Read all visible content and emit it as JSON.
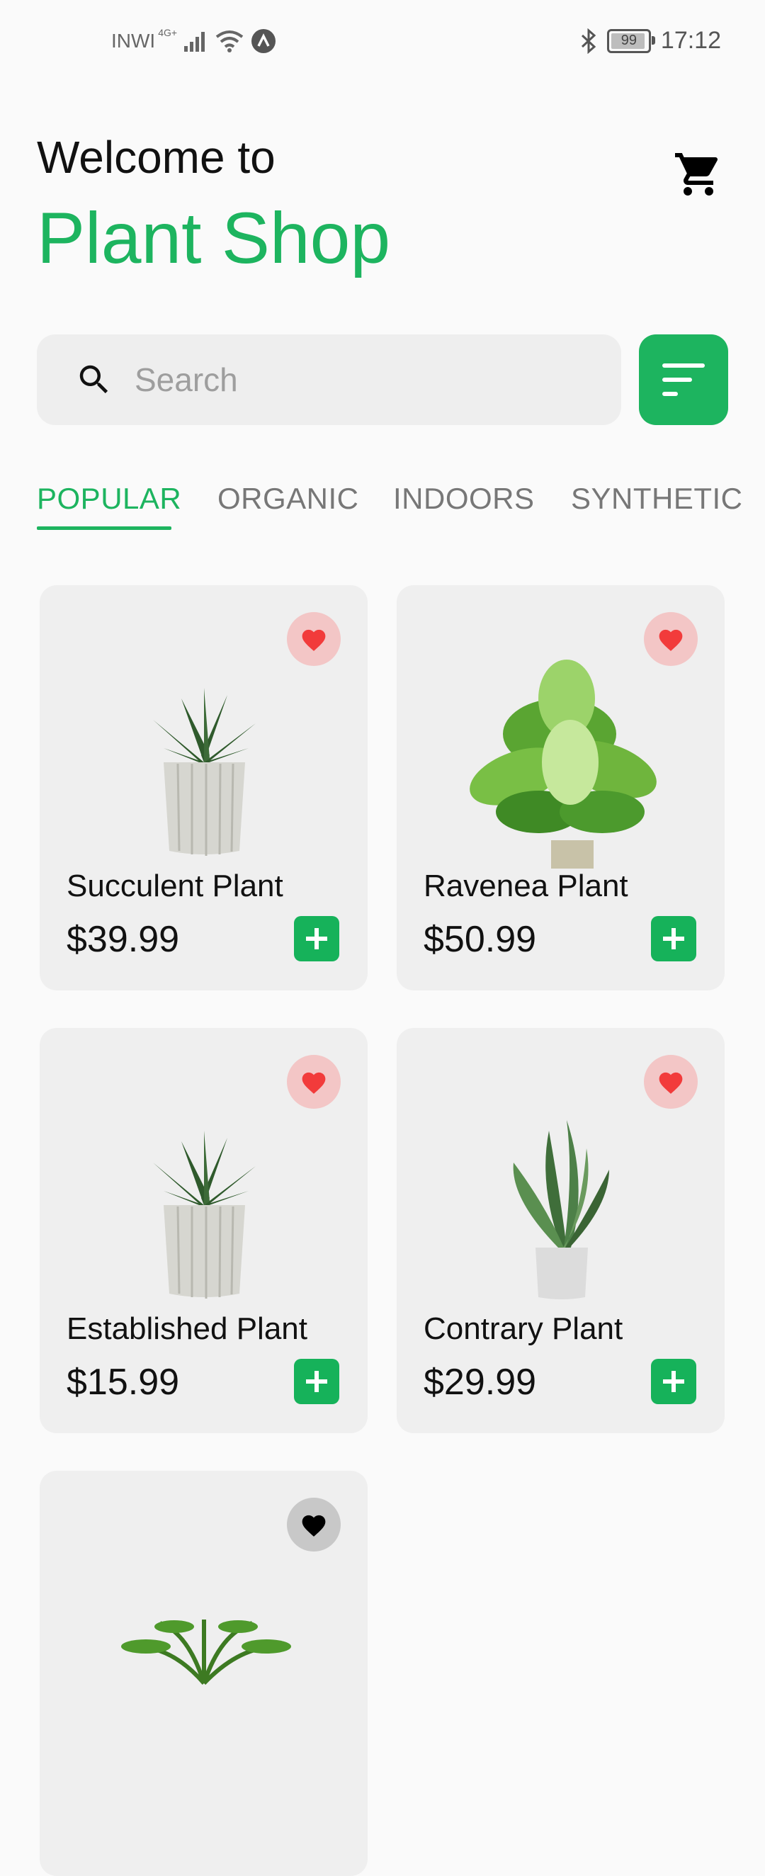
{
  "status_bar": {
    "carrier": "INWI",
    "network": "4G+",
    "battery": "99",
    "time": "17:12"
  },
  "header": {
    "welcome": "Welcome to",
    "title": "Plant Shop",
    "cart_icon": "cart-icon"
  },
  "search": {
    "placeholder": "Search",
    "filter_icon": "filter-icon"
  },
  "tabs": [
    {
      "label": "POPULAR",
      "active": true
    },
    {
      "label": "ORGANIC",
      "active": false
    },
    {
      "label": "INDOORS",
      "active": false
    },
    {
      "label": "SYNTHETIC",
      "active": false
    }
  ],
  "products": [
    {
      "name": "Succulent Plant",
      "price": "$39.99",
      "favorite": true
    },
    {
      "name": "Ravenea Plant",
      "price": "$50.99",
      "favorite": true
    },
    {
      "name": "Established Plant",
      "price": "$15.99",
      "favorite": true
    },
    {
      "name": "Contrary Plant",
      "price": "$29.99",
      "favorite": true
    },
    {
      "name": "",
      "price": "",
      "favorite": false
    }
  ],
  "colors": {
    "accent": "#1db45f",
    "heart": "#f23b3b",
    "card_bg": "#efefef"
  }
}
